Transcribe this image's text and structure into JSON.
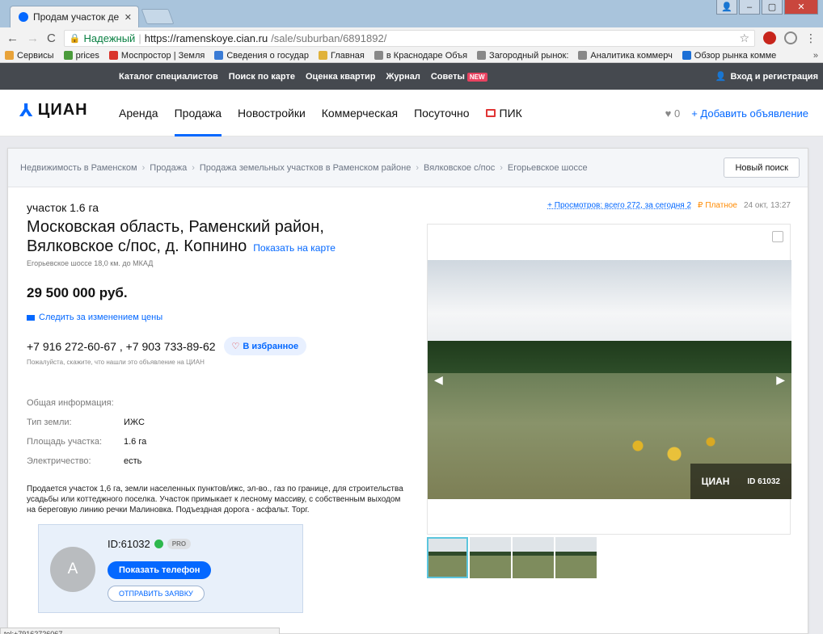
{
  "browser": {
    "tab_title": "Продам участок дерев",
    "secure_label": "Надежный",
    "url_host": "https://ramenskoye.cian.ru",
    "url_path": "/sale/suburban/6891892/",
    "bookmarks": [
      "Сервисы",
      "prices",
      "Моспростор | Земля",
      "Сведения о государ",
      "Главная",
      "в Краснодаре Объя",
      "Загородный рынок:",
      "Аналитика коммерч",
      "Обзор рынка комме"
    ],
    "bookmark_colors": [
      "#e8a33a",
      "#4a9b3b",
      "#d9342b",
      "#3a7bd5",
      "#e0b23a",
      "#888888",
      "#888888",
      "#888888",
      "#1b6fd6"
    ],
    "more": "»",
    "status_url": "tel:+79162726067"
  },
  "topbar": {
    "links": [
      "Каталог специалистов",
      "Поиск по карте",
      "Оценка квартир",
      "Журнал",
      "Советы"
    ],
    "new_badge": "NEW",
    "login": "Вход и регистрация"
  },
  "header": {
    "logo": "ЦИАН",
    "nav": [
      "Аренда",
      "Продажа",
      "Новостройки",
      "Коммерческая",
      "Посуточно"
    ],
    "active_nav": "Продажа",
    "pik": "ПИК",
    "fav_count": "0",
    "add_listing": "+ Добавить объявление",
    "brand_color": "#0468ff"
  },
  "breadcrumbs": {
    "items": [
      "Недвижимость в Раменском",
      "Продажа",
      "Продажа земельных участков в Раменском районе",
      "Вялковское с/пос",
      "Егорьевское шоссе"
    ],
    "new_search": "Новый поиск"
  },
  "listing": {
    "type": "участок 1.6 га",
    "address": "Московская область, Раменский район, Вялковское с/пос, д. Копнино",
    "map_link": "Показать на карте",
    "highway": "Егорьевское шоссе 18,0 км. до МКАД",
    "price": "29 500 000 руб.",
    "follow_price": "Следить за изменением цены",
    "phones": "+7 916 272-60-67 , +7 903 733-89-62",
    "favorite": "В избранное",
    "hint": "Пожалуйста, скажите, что нашли это объявление на ЦИАН",
    "general_info": "Общая информация:",
    "params": [
      {
        "k": "Тип земли:",
        "v": "ИЖС"
      },
      {
        "k": "Площадь участка:",
        "v": "1.6 га"
      },
      {
        "k": "Электричество:",
        "v": "есть"
      }
    ],
    "description": "Продается участок 1,6 га, земли населенных пунктов/ижс, эл-во., газ по границе, для строительства усадьбы или коттеджного поселка. Участок примыкает к лесному массиву, с собственным выходом на береговую линию речки Малиновка. Подъездная дорога - асфальт. Торг."
  },
  "agent": {
    "avatar_letter": "A",
    "id": "ID:61032",
    "pro": "PRO",
    "show_phone": "Показать телефон",
    "send_request": "ОТПРАВИТЬ ЗАЯВКУ"
  },
  "meta": {
    "views": "+ Просмотров: всего 272, за сегодня 2",
    "paid": "Платное",
    "date": "24 окт, 13:27"
  },
  "gallery": {
    "watermark_brand": "ЦИАН",
    "watermark_id": "ID 61032",
    "thumb_count": 4
  }
}
